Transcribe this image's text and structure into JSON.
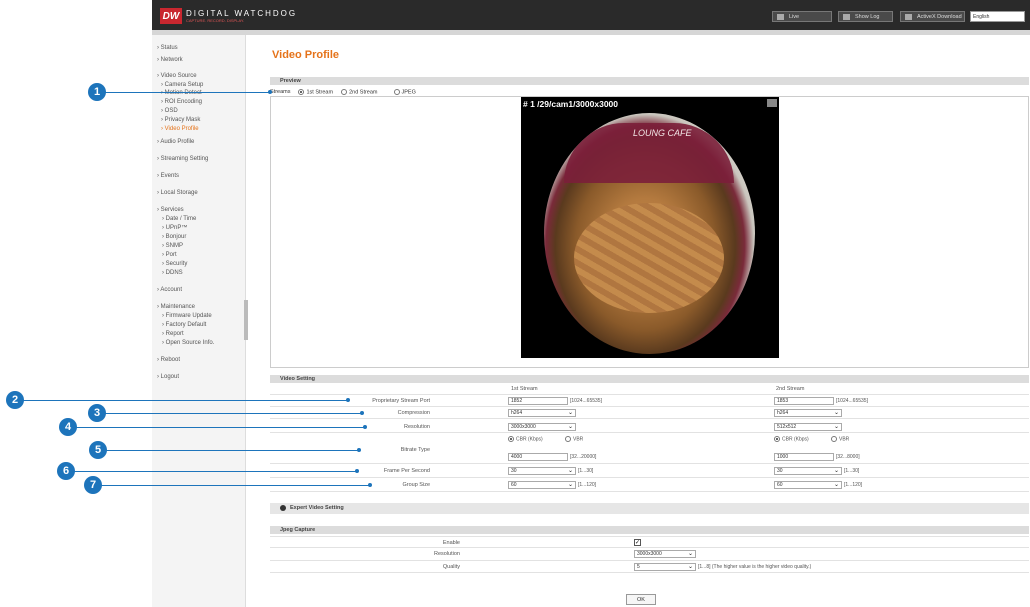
{
  "header": {
    "logo_mark": "DW",
    "logo_text": "DIGITAL WATCHDOG",
    "logo_sub": "CAPTURE. RECORD. DISPLAY.",
    "buttons": [
      {
        "label": "Live",
        "icon": "live-icon"
      },
      {
        "label": "Show Log",
        "icon": "log-icon"
      },
      {
        "label": "ActiveX Download",
        "icon": "download-icon"
      }
    ],
    "language": "English"
  },
  "sidebar": {
    "items": [
      {
        "label": "› Status"
      },
      {
        "label": "› Network"
      },
      {
        "label": "› Video Source"
      },
      {
        "label": "› Camera Setup"
      },
      {
        "label": "› Motion Detect"
      },
      {
        "label": "› ROI Encoding"
      },
      {
        "label": "› OSD"
      },
      {
        "label": "› Privacy Mask"
      },
      {
        "label": "› Video Profile"
      },
      {
        "label": "› Audio Profile"
      },
      {
        "label": "› Streaming Setting"
      },
      {
        "label": "› Events"
      },
      {
        "label": "› Local Storage"
      },
      {
        "label": "› Services"
      },
      {
        "label": "› Date / Time"
      },
      {
        "label": "› UPnP™"
      },
      {
        "label": "› Bonjour"
      },
      {
        "label": "› SNMP"
      },
      {
        "label": "› Port"
      },
      {
        "label": "› Security"
      },
      {
        "label": "› DDNS"
      },
      {
        "label": "› Account"
      },
      {
        "label": "› Maintenance"
      },
      {
        "label": "› Firmware Update"
      },
      {
        "label": "› Factory Default"
      },
      {
        "label": "› Report"
      },
      {
        "label": "› Open Source Info."
      },
      {
        "label": "› Reboot"
      },
      {
        "label": "› Logout"
      }
    ],
    "active_index": 8,
    "accent": "#e5731a"
  },
  "main": {
    "title": "Video Profile",
    "preview": {
      "section_label": "Preview",
      "streams_label": "Streams",
      "options": [
        "1st Stream",
        "2nd Stream",
        "JPEG"
      ],
      "selected": "1st Stream",
      "video_title": "# 1  /29/cam1/3000x3000",
      "sign_text": "LOUNG CAFE"
    },
    "video_setting": {
      "section_label": "Video Setting",
      "col1": "1st Stream",
      "col2": "2nd Stream",
      "rows": {
        "port": {
          "label": "Proprietary Stream Port",
          "v1": "1852",
          "v2": "1853",
          "hint": "[1024...65535]"
        },
        "compression": {
          "label": "Compression",
          "v1": "h264",
          "v2": "h264"
        },
        "resolution": {
          "label": "Resolution",
          "v1": "3000x3000",
          "v2": "512x512"
        },
        "bitrate": {
          "label": "Bitrate Type",
          "cbr": "CBR (Kbps)",
          "vbr": "VBR",
          "v1": "4000",
          "v2": "1000",
          "hint": "[32...20000]",
          "hint2": "[32...8000]"
        },
        "fps": {
          "label": "Frame Per Second",
          "v1": "30",
          "v2": "30",
          "hint": "[1...30]"
        },
        "group": {
          "label": "Group Size",
          "v1": "60",
          "v2": "60",
          "hint": "[1...120]"
        }
      }
    },
    "expert": {
      "label": "Expert Video Setting"
    },
    "jpeg": {
      "section_label": "Jpeg Capture",
      "enable_label": "Enable",
      "resolution_label": "Resolution",
      "resolution_value": "3000x3000",
      "quality_label": "Quality",
      "quality_value": "5",
      "quality_hint": "[1...8] (The higher value is the higher video quality.)"
    },
    "ok_label": "OK"
  },
  "annotations": {
    "numbers": [
      "1",
      "2",
      "3",
      "4",
      "5",
      "6",
      "7"
    ],
    "color": "#1d74bb"
  }
}
